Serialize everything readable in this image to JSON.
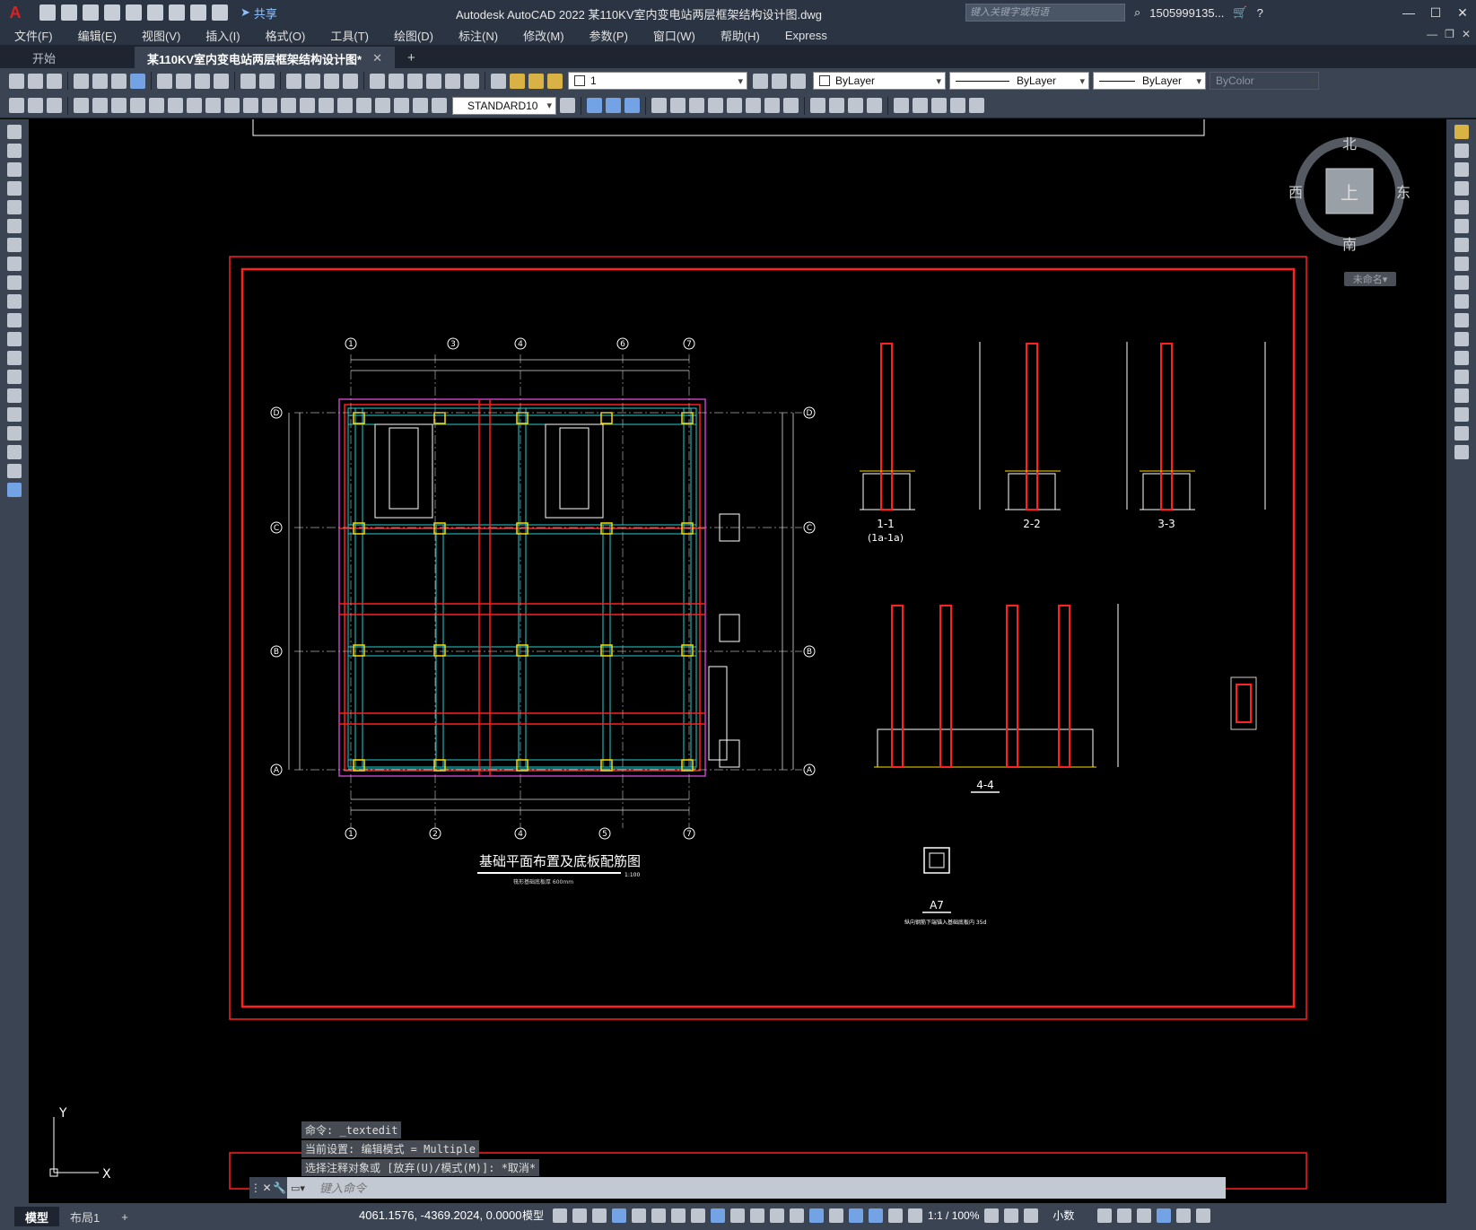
{
  "app": {
    "logo": "A",
    "title": "Autodesk AutoCAD 2022    某110KV室内变电站两层框架结构设计图.dwg",
    "share_label": "共享",
    "search_placeholder": "键入关键字或短语",
    "user": "1505999135...",
    "window_controls": [
      "—",
      "☐",
      "✕"
    ]
  },
  "menu": [
    "文件(F)",
    "编辑(E)",
    "视图(V)",
    "插入(I)",
    "格式(O)",
    "工具(T)",
    "绘图(D)",
    "标注(N)",
    "修改(M)",
    "参数(P)",
    "窗口(W)",
    "帮助(H)",
    "Express"
  ],
  "tabs": {
    "start": "开始",
    "active": "某110KV室内变电站两层框架结构设计图*",
    "close": "✕",
    "add": "+"
  },
  "toolbar": {
    "layer": "1",
    "color": "ByLayer",
    "linetype": "ByLayer",
    "lineweight": "ByLayer",
    "plotstyle": "ByColor",
    "dimstyle": "STANDARD10"
  },
  "viewcube": {
    "north": "北",
    "south": "南",
    "east": "东",
    "west": "西",
    "top": "上",
    "ucs_menu": "未命名"
  },
  "drawing": {
    "main_title": "基础平面布置及底板配筋图",
    "main_scale": "1:100",
    "main_note": "筏形基础底板厚 600mm",
    "axis_cols": [
      "1",
      "3",
      "4",
      "6",
      "7"
    ],
    "axis_cols_bottom": [
      "1",
      "2",
      "4",
      "5",
      "7"
    ],
    "axis_rows": [
      "D",
      "C",
      "B",
      "A"
    ],
    "sections": [
      "1-1",
      "2-2",
      "3-3"
    ],
    "section_1_sub": "(1a-1a)",
    "section_4": "4-4",
    "detail_a": "A7",
    "detail_note": "纵向钢筋下端锚入基础底板内 35d"
  },
  "ucs_icon": {
    "x": "X",
    "y": "Y"
  },
  "command": {
    "history": [
      "命令: _textedit",
      "当前设置: 编辑模式 = Multiple",
      "选择注释对象或 [放弃(U)/模式(M)]: *取消*"
    ],
    "placeholder": "键入命令"
  },
  "status": {
    "layout_tabs": [
      "模型",
      "布局1",
      "+"
    ],
    "coords": "4061.1576, -4369.2024, 0.0000",
    "model_label": "模型",
    "scale": "1:1 / 100%",
    "units": "小数"
  }
}
